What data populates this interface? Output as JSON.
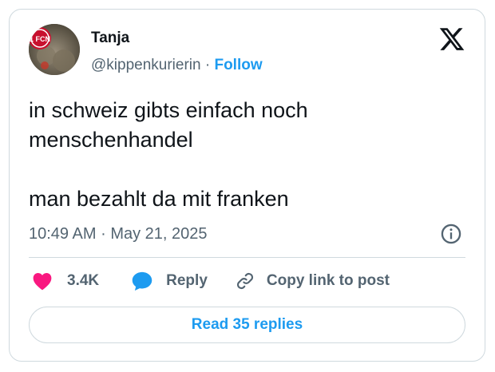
{
  "author": {
    "name": "Tanja",
    "handle": "@kippenkurierin",
    "separator": "·",
    "follow_label": "Follow",
    "avatar_badge_text": "1 FCN"
  },
  "brand": {
    "logo": "x-logo-icon"
  },
  "tweet": {
    "lines": [
      "in schweiz gibts einfach noch",
      "menschenhandel",
      "",
      "man bezahlt da mit franken"
    ]
  },
  "meta": {
    "time": "10:49 AM",
    "separator": "·",
    "date": "May 21, 2025",
    "info_icon": "info-icon"
  },
  "actions": {
    "like_count": "3.4K",
    "reply_label": "Reply",
    "copy_label": "Copy link to post"
  },
  "read_replies_label": "Read 35 replies",
  "colors": {
    "accent": "#1d9bf0",
    "like": "#f91880",
    "text": "#0f1419",
    "secondary": "#536471",
    "border": "#cfd9de"
  }
}
